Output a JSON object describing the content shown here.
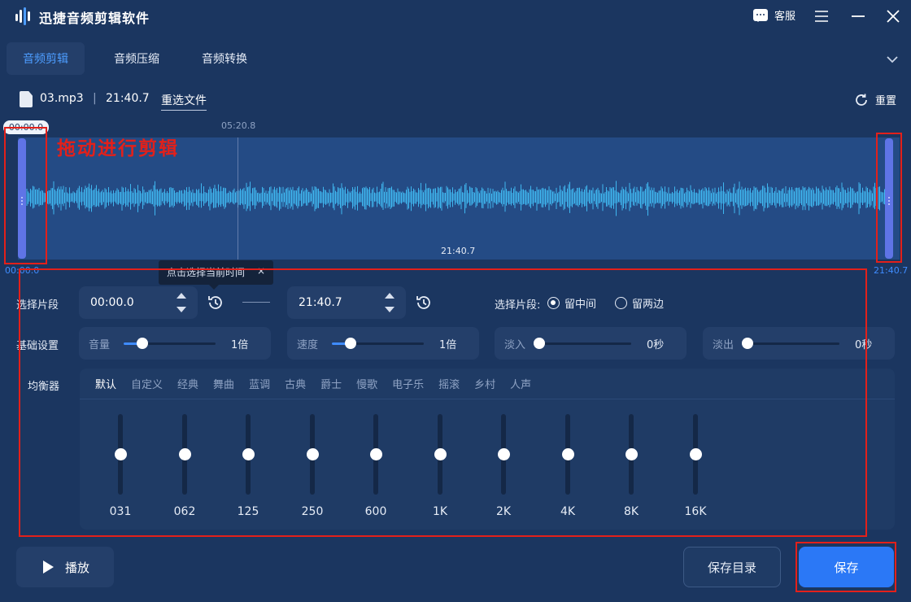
{
  "app": {
    "title": "迅捷音频剪辑软件",
    "service_label": "客服",
    "icons": {
      "logo": "app-logo-icon",
      "service": "chat-icon",
      "menu": "menu-icon",
      "minimize": "minimize-icon",
      "close": "close-icon"
    }
  },
  "tabs": [
    {
      "label": "音频剪辑",
      "active": true
    },
    {
      "label": "音频压缩",
      "active": false
    },
    {
      "label": "音频转换",
      "active": false
    }
  ],
  "file": {
    "name": "03.mp3",
    "separator": "|",
    "duration": "21:40.7",
    "reselect_label": "重选文件",
    "reset_label": "重置"
  },
  "waveform": {
    "start_chip": "00:00.0",
    "ruler_mid": "05:20.8",
    "center_time": "21:40.7",
    "start_time": "00:00.0",
    "end_time": "21:40.7",
    "annotation": "拖动进行剪辑",
    "accent_color": "#3fb7f0"
  },
  "tooltip": {
    "text": "点击选择当前时间",
    "close": "×"
  },
  "segment": {
    "label": "选择片段",
    "start_value": "00:00.0",
    "end_value": "21:40.7",
    "mode_label": "选择片段:",
    "options": [
      {
        "label": "留中间",
        "selected": true
      },
      {
        "label": "留两边",
        "selected": false
      }
    ]
  },
  "basic": {
    "label": "基础设置",
    "volume": {
      "label": "音量",
      "value": "1倍",
      "level": 0.2
    },
    "speed": {
      "label": "速度",
      "value": "1倍",
      "level": 0.2
    },
    "fade_in": {
      "label": "淡入",
      "value": "0秒",
      "level": 0
    },
    "fade_out": {
      "label": "淡出",
      "value": "0秒",
      "level": 0
    }
  },
  "equalizer": {
    "label": "均衡器",
    "presets": [
      "默认",
      "自定义",
      "经典",
      "舞曲",
      "蓝调",
      "古典",
      "爵士",
      "慢歌",
      "电子乐",
      "摇滚",
      "乡村",
      "人声"
    ],
    "active_preset": "默认",
    "bands": [
      {
        "label": "031",
        "level": 0.5
      },
      {
        "label": "062",
        "level": 0.5
      },
      {
        "label": "125",
        "level": 0.5
      },
      {
        "label": "250",
        "level": 0.5
      },
      {
        "label": "600",
        "level": 0.5
      },
      {
        "label": "1K",
        "level": 0.5
      },
      {
        "label": "2K",
        "level": 0.5
      },
      {
        "label": "4K",
        "level": 0.5
      },
      {
        "label": "8K",
        "level": 0.5
      },
      {
        "label": "16K",
        "level": 0.5
      }
    ]
  },
  "buttons": {
    "play": "播放",
    "save_dir": "保存目录",
    "save": "保存"
  }
}
